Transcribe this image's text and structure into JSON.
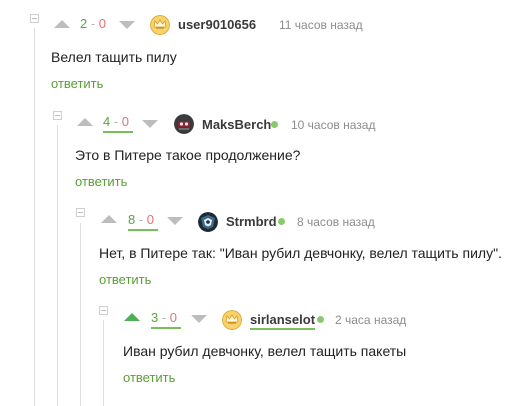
{
  "comments": [
    {
      "score_plus": "2",
      "score_sep": " - ",
      "score_minus": "0",
      "username": "user9010656",
      "time": "11 часов назад",
      "text": "Велел тащить пилу",
      "reply": "ответить",
      "avatar_icon": "default-avatar-icon",
      "online": false
    },
    {
      "score_plus": "4",
      "score_sep": " - ",
      "score_minus": "0",
      "username": "MaksBerch",
      "time": "10 часов назад",
      "text": "Это в Питере такое продолжение?",
      "reply": "ответить",
      "avatar_icon": "user-avatar-icon",
      "online": true
    },
    {
      "score_plus": "8",
      "score_sep": " - ",
      "score_minus": "0",
      "username": "Strmbrd",
      "time": "8 часов назад",
      "text": "Нет, в Питере так: \"Иван рубил девчонку, велел тащить пилу\".",
      "reply": "ответить",
      "avatar_icon": "user-avatar-icon",
      "online": true
    },
    {
      "score_plus": "3",
      "score_sep": " - ",
      "score_minus": "0",
      "username": "sirlanselot",
      "time": "2 часа назад",
      "text": "Иван рубил девчонку, велел тащить пакеты",
      "reply": "ответить",
      "avatar_icon": "default-avatar-icon",
      "online": true,
      "upvoted": true
    }
  ],
  "colors": {
    "positive": "#5aa53e",
    "negative": "#e57373",
    "link": "#5a9e34",
    "online": "#8ac96c"
  }
}
